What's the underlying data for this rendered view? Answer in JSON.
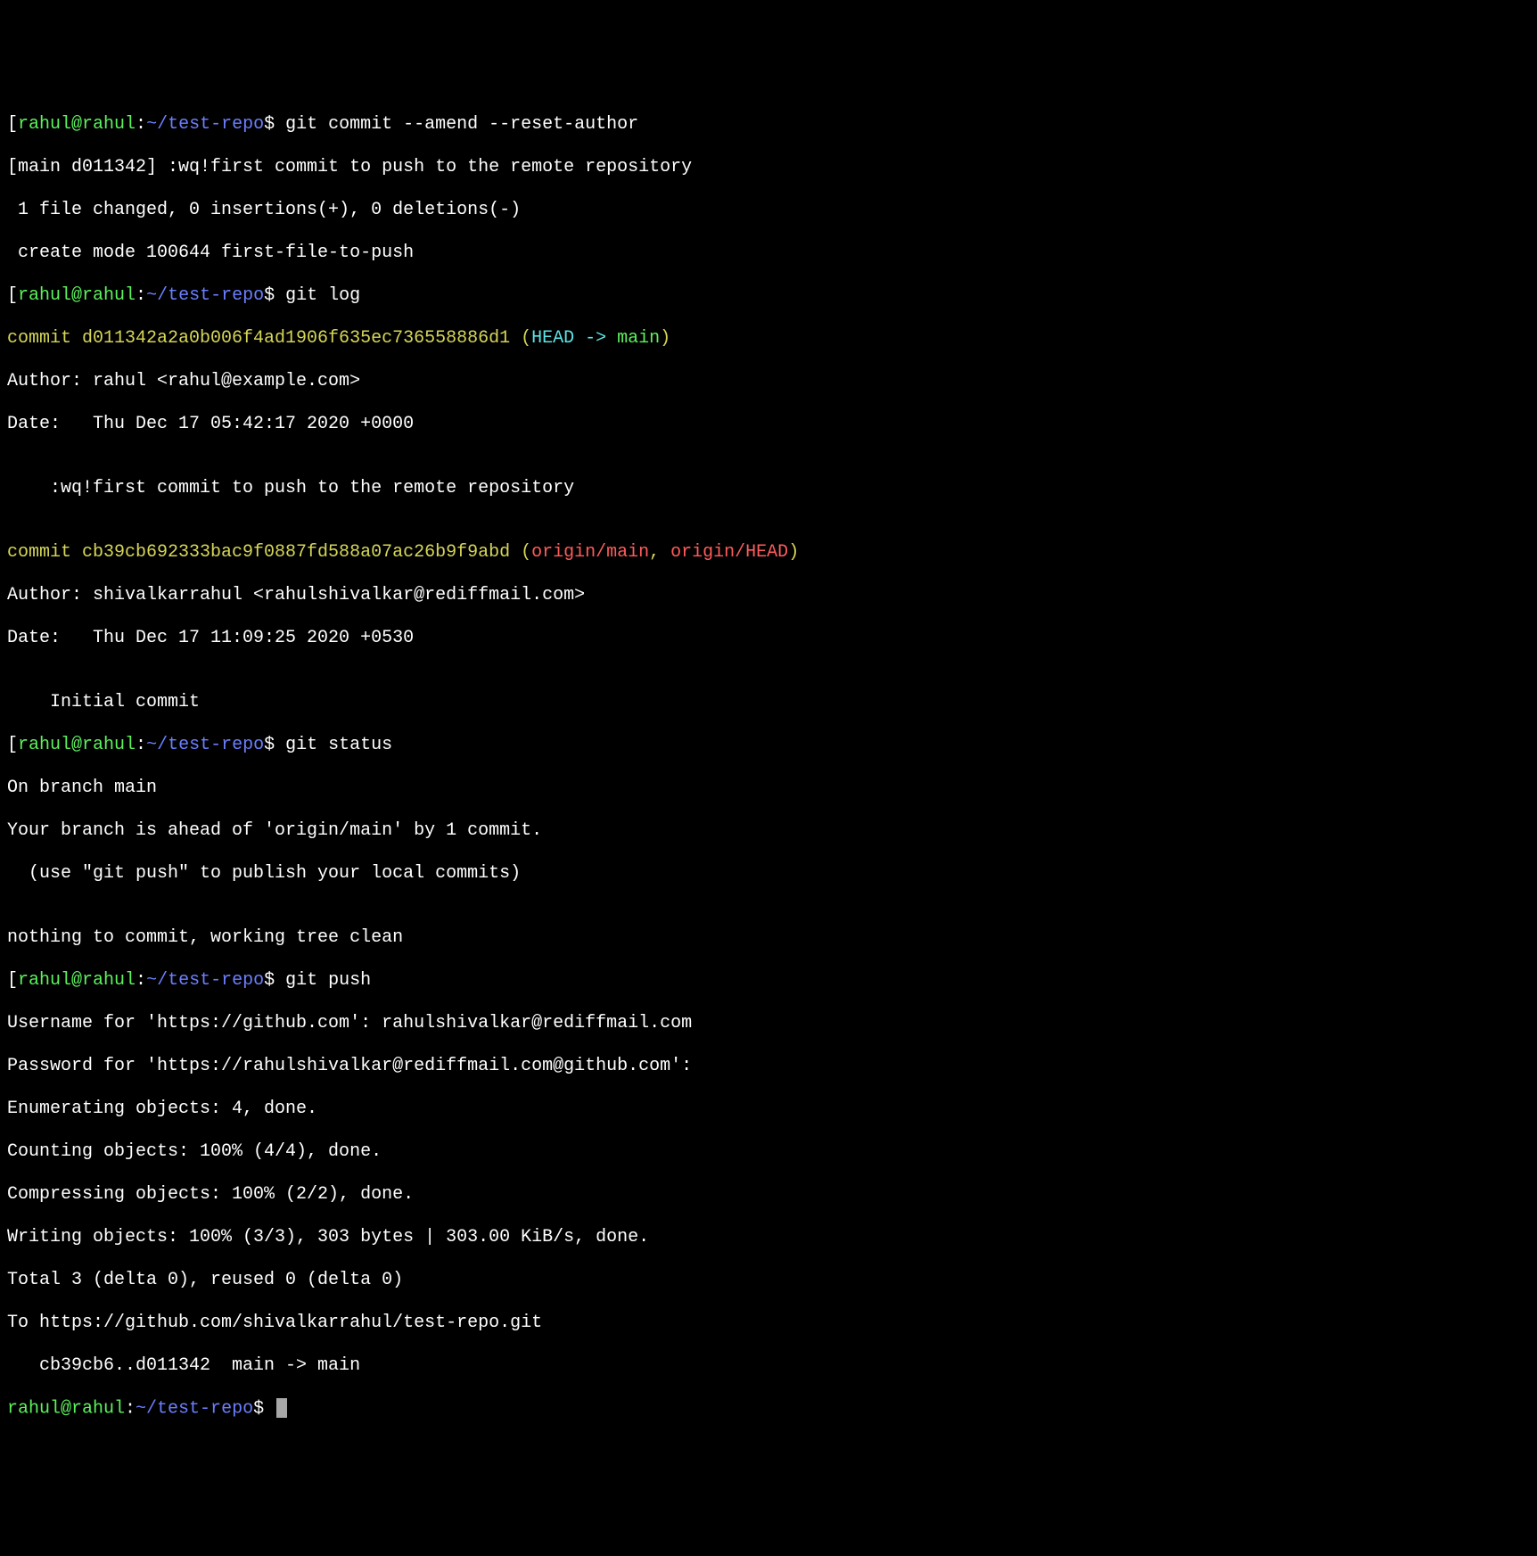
{
  "prompts": {
    "user": "rahul@rahul",
    "sep": ":",
    "path": "~/test-repo",
    "dollar": "$ "
  },
  "commands": {
    "amend": "git commit --amend --reset-author",
    "log": "git log",
    "status": "git status",
    "push": "git push"
  },
  "amend_output": {
    "line1": "[main d011342] :wq!first commit to push to the remote repository",
    "line2": " 1 file changed, 0 insertions(+), 0 deletions(-)",
    "line3": " create mode 100644 first-file-to-push"
  },
  "log_output": {
    "commit1": {
      "prefix": "commit d011342a2a0b006f4ad1906f635ec736558886d1 (",
      "head": "HEAD -> ",
      "branch": "main",
      "suffix": ")",
      "author": "Author: rahul <rahul@example.com>",
      "date": "Date:   Thu Dec 17 05:42:17 2020 +0000",
      "blank": "",
      "msg": "    :wq!first commit to push to the remote repository"
    },
    "commit2": {
      "prefix": "commit cb39cb692333bac9f0887fd588a07ac26b9f9abd (",
      "remote1": "origin/main",
      "comma": ", ",
      "remote2": "origin/HEAD",
      "suffix": ")",
      "author": "Author: shivalkarrahul <rahulshivalkar@rediffmail.com>",
      "date": "Date:   Thu Dec 17 11:09:25 2020 +0530",
      "blank": "",
      "msg": "    Initial commit"
    }
  },
  "status_output": {
    "line1": "On branch main",
    "line2": "Your branch is ahead of 'origin/main' by 1 commit.",
    "line3": "  (use \"git push\" to publish your local commits)",
    "blank": "",
    "line4": "nothing to commit, working tree clean"
  },
  "push_output": {
    "line1": "Username for 'https://github.com': rahulshivalkar@rediffmail.com",
    "line2": "Password for 'https://rahulshivalkar@rediffmail.com@github.com':",
    "line3": "Enumerating objects: 4, done.",
    "line4": "Counting objects: 100% (4/4), done.",
    "line5": "Compressing objects: 100% (2/2), done.",
    "line6": "Writing objects: 100% (3/3), 303 bytes | 303.00 KiB/s, done.",
    "line7": "Total 3 (delta 0), reused 0 (delta 0)",
    "line8": "To https://github.com/shivalkarrahul/test-repo.git",
    "line9": "   cb39cb6..d011342  main -> main"
  }
}
